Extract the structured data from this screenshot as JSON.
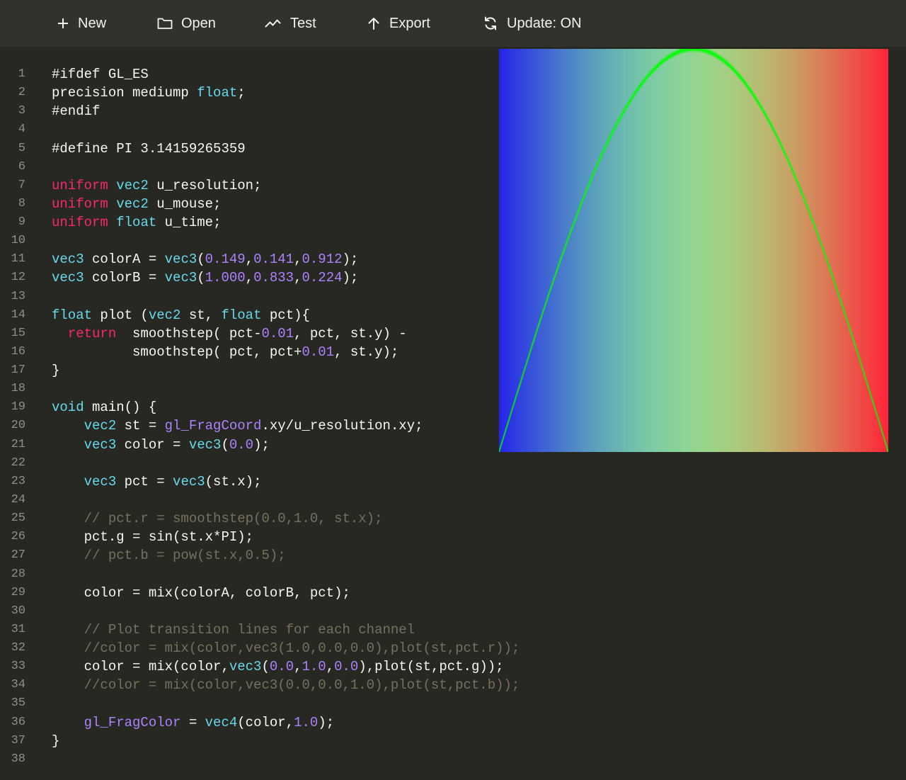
{
  "toolbar": {
    "new_label": "New",
    "open_label": "Open",
    "test_label": "Test",
    "export_label": "Export",
    "update_label": "Update: ON"
  },
  "code_lines": [
    [
      {
        "t": "#ifdef GL_ES"
      }
    ],
    [
      {
        "t": "precision mediump "
      },
      {
        "t": "float",
        "c": "k"
      },
      {
        "t": ";"
      }
    ],
    [
      {
        "t": "#endif"
      }
    ],
    [],
    [
      {
        "t": "#define PI 3.14159265359"
      }
    ],
    [],
    [
      {
        "t": "uniform",
        "c": "m"
      },
      {
        "t": " "
      },
      {
        "t": "vec2",
        "c": "k"
      },
      {
        "t": " u_resolution;"
      }
    ],
    [
      {
        "t": "uniform",
        "c": "m"
      },
      {
        "t": " "
      },
      {
        "t": "vec2",
        "c": "k"
      },
      {
        "t": " u_mouse;"
      }
    ],
    [
      {
        "t": "uniform",
        "c": "m"
      },
      {
        "t": " "
      },
      {
        "t": "float",
        "c": "k"
      },
      {
        "t": " u_time;"
      }
    ],
    [],
    [
      {
        "t": "vec3",
        "c": "k"
      },
      {
        "t": " colorA = "
      },
      {
        "t": "vec3",
        "c": "k"
      },
      {
        "t": "("
      },
      {
        "t": "0.149",
        "c": "n"
      },
      {
        "t": ","
      },
      {
        "t": "0.141",
        "c": "n"
      },
      {
        "t": ","
      },
      {
        "t": "0.912",
        "c": "n"
      },
      {
        "t": ");"
      }
    ],
    [
      {
        "t": "vec3",
        "c": "k"
      },
      {
        "t": " colorB = "
      },
      {
        "t": "vec3",
        "c": "k"
      },
      {
        "t": "("
      },
      {
        "t": "1.000",
        "c": "n"
      },
      {
        "t": ","
      },
      {
        "t": "0.833",
        "c": "n"
      },
      {
        "t": ","
      },
      {
        "t": "0.224",
        "c": "n"
      },
      {
        "t": ");"
      }
    ],
    [],
    [
      {
        "t": "float",
        "c": "k"
      },
      {
        "t": " plot ("
      },
      {
        "t": "vec2",
        "c": "k"
      },
      {
        "t": " st, "
      },
      {
        "t": "float",
        "c": "k"
      },
      {
        "t": " pct){"
      }
    ],
    [
      {
        "t": "  "
      },
      {
        "t": "return",
        "c": "m"
      },
      {
        "t": "  smoothstep( pct-"
      },
      {
        "t": "0.01",
        "c": "n"
      },
      {
        "t": ", pct, st.y) -"
      }
    ],
    [
      {
        "t": "          smoothstep( pct, pct+"
      },
      {
        "t": "0.01",
        "c": "n"
      },
      {
        "t": ", st.y);"
      }
    ],
    [
      {
        "t": "}"
      }
    ],
    [],
    [
      {
        "t": "void",
        "c": "k"
      },
      {
        "t": " main() {"
      }
    ],
    [
      {
        "t": "    "
      },
      {
        "t": "vec2",
        "c": "k"
      },
      {
        "t": " st = "
      },
      {
        "t": "gl_FragCoord",
        "c": "g"
      },
      {
        "t": ".xy/u_resolution.xy;"
      }
    ],
    [
      {
        "t": "    "
      },
      {
        "t": "vec3",
        "c": "k"
      },
      {
        "t": " color = "
      },
      {
        "t": "vec3",
        "c": "k"
      },
      {
        "t": "("
      },
      {
        "t": "0.0",
        "c": "n"
      },
      {
        "t": ");"
      }
    ],
    [],
    [
      {
        "t": "    "
      },
      {
        "t": "vec3",
        "c": "k"
      },
      {
        "t": " pct = "
      },
      {
        "t": "vec3",
        "c": "k"
      },
      {
        "t": "(st.x);"
      }
    ],
    [],
    [
      {
        "t": "    "
      },
      {
        "t": "// pct.r = smoothstep(0.0,1.0, st.x);",
        "c": "c"
      }
    ],
    [
      {
        "t": "    pct.g = sin(st.x*PI);"
      }
    ],
    [
      {
        "t": "    "
      },
      {
        "t": "// pct.b = pow(st.x,0.5);",
        "c": "c"
      }
    ],
    [],
    [
      {
        "t": "    color = mix(colorA, colorB, pct);"
      }
    ],
    [],
    [
      {
        "t": "    "
      },
      {
        "t": "// Plot transition lines for each channel",
        "c": "c"
      }
    ],
    [
      {
        "t": "    "
      },
      {
        "t": "//color = mix(color,vec3(1.0,0.0,0.0),plot(st,pct.r));",
        "c": "c"
      }
    ],
    [
      {
        "t": "    color = mix(color,"
      },
      {
        "t": "vec3",
        "c": "k"
      },
      {
        "t": "("
      },
      {
        "t": "0.0",
        "c": "n"
      },
      {
        "t": ","
      },
      {
        "t": "1.0",
        "c": "n"
      },
      {
        "t": ","
      },
      {
        "t": "0.0",
        "c": "n"
      },
      {
        "t": "),plot(st,pct.g));"
      }
    ],
    [
      {
        "t": "    "
      },
      {
        "t": "//color = mix(color,vec3(0.0,0.0,1.0),plot(st,pct.b));",
        "c": "c"
      }
    ],
    [],
    [
      {
        "t": "    "
      },
      {
        "t": "gl_FragColor",
        "c": "g"
      },
      {
        "t": " = "
      },
      {
        "t": "vec4",
        "c": "k"
      },
      {
        "t": "(color,"
      },
      {
        "t": "1.0",
        "c": "n"
      },
      {
        "t": ");"
      }
    ],
    [
      {
        "t": "}"
      }
    ],
    []
  ],
  "shader_preview": {
    "colorA": [
      0.149,
      0.141,
      0.912
    ],
    "colorB": [
      1.0,
      0.833,
      0.224
    ],
    "plot_color": [
      0.0,
      1.0,
      0.0
    ]
  }
}
